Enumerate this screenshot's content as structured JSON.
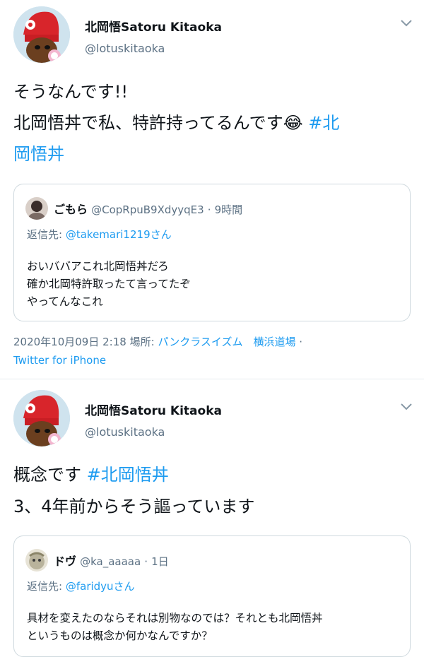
{
  "tweets": [
    {
      "author_name": "北岡悟Satoru Kitaoka",
      "handle": "@lotuskitaoka",
      "line1": "そうなんです!!",
      "line2_text": "北岡悟丼で私、特許持ってるんです",
      "line2_emoji": "😂",
      "line2_hashtag": "#北",
      "line3_hashtag": "岡悟丼",
      "quote": {
        "name": "ごもら",
        "handle": "@CopRpuB9XdyyqE3",
        "separator": "·",
        "time": "9時間",
        "reply_prefix": "返信先:",
        "reply_to": "@takemari1219さん",
        "lines": [
          "おいババアこれ北岡悟丼だろ",
          "確か北岡特許取ったて言ってたぞ",
          "やってんなこれ"
        ]
      },
      "meta": {
        "datetime": "2020年10月09日 2:18",
        "place_label": "場所:",
        "place": "パンクラスイズム　横浜道場",
        "separator": "·",
        "client": "Twitter for iPhone"
      }
    },
    {
      "author_name": "北岡悟Satoru Kitaoka",
      "handle": "@lotuskitaoka",
      "line1_text": "概念です",
      "line1_hashtag": "#北岡悟丼",
      "line2": "3、4年前からそう謳っています",
      "quote": {
        "name": "ドヴ",
        "handle": "@ka_aaaaa",
        "separator": "·",
        "time": "1日",
        "reply_prefix": "返信先:",
        "reply_to": "@faridyuさん",
        "lines": [
          "具材を変えたのならそれは別物なのでは？それとも北岡悟丼",
          "というものは概念か何かなんですか？"
        ]
      }
    }
  ],
  "icons": [
    "chevron-down-icon",
    "avatar",
    "quote-avatar"
  ],
  "colors": {
    "link": "#1d9bf0",
    "secondary_text": "#5b7083",
    "border": "#cfd9de"
  }
}
